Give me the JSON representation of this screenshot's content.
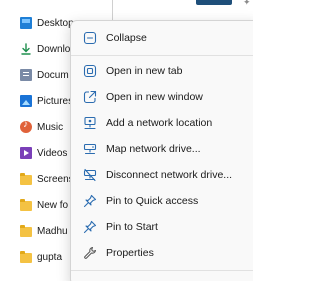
{
  "nav_pane": {
    "items": [
      {
        "label": "Desktop",
        "icon": "desktop-folder-icon"
      },
      {
        "label": "Downlo",
        "icon": "downloads-arrow-icon"
      },
      {
        "label": "Docum",
        "icon": "documents-folder-icon"
      },
      {
        "label": "Pictures",
        "icon": "pictures-folder-icon"
      },
      {
        "label": "Music",
        "icon": "music-folder-icon"
      },
      {
        "label": "Videos",
        "icon": "videos-folder-icon"
      },
      {
        "label": "Screens",
        "icon": "folder-icon"
      },
      {
        "label": "New fo",
        "icon": "folder-icon"
      },
      {
        "label": "Madhu",
        "icon": "folder-icon"
      },
      {
        "label": "gupta",
        "icon": "folder-icon"
      }
    ]
  },
  "context_menu": {
    "items": [
      {
        "label": "Collapse",
        "icon": "collapse-icon"
      },
      {
        "label": "Open in new tab",
        "icon": "new-tab-icon"
      },
      {
        "label": "Open in new window",
        "icon": "new-window-icon"
      },
      {
        "label": "Add a network location",
        "icon": "network-location-icon"
      },
      {
        "label": "Map network drive...",
        "icon": "map-network-drive-icon"
      },
      {
        "label": "Disconnect network drive...",
        "icon": "disconnect-network-drive-icon"
      },
      {
        "label": "Pin to Quick access",
        "icon": "pin-icon"
      },
      {
        "label": "Pin to Start",
        "icon": "pin-icon"
      },
      {
        "label": "Properties",
        "icon": "wrench-icon"
      }
    ]
  },
  "colors": {
    "menu_background": "#f9f9f9",
    "icon_blue": "#2b6cb0",
    "folder_yellow": "#f4c243"
  }
}
